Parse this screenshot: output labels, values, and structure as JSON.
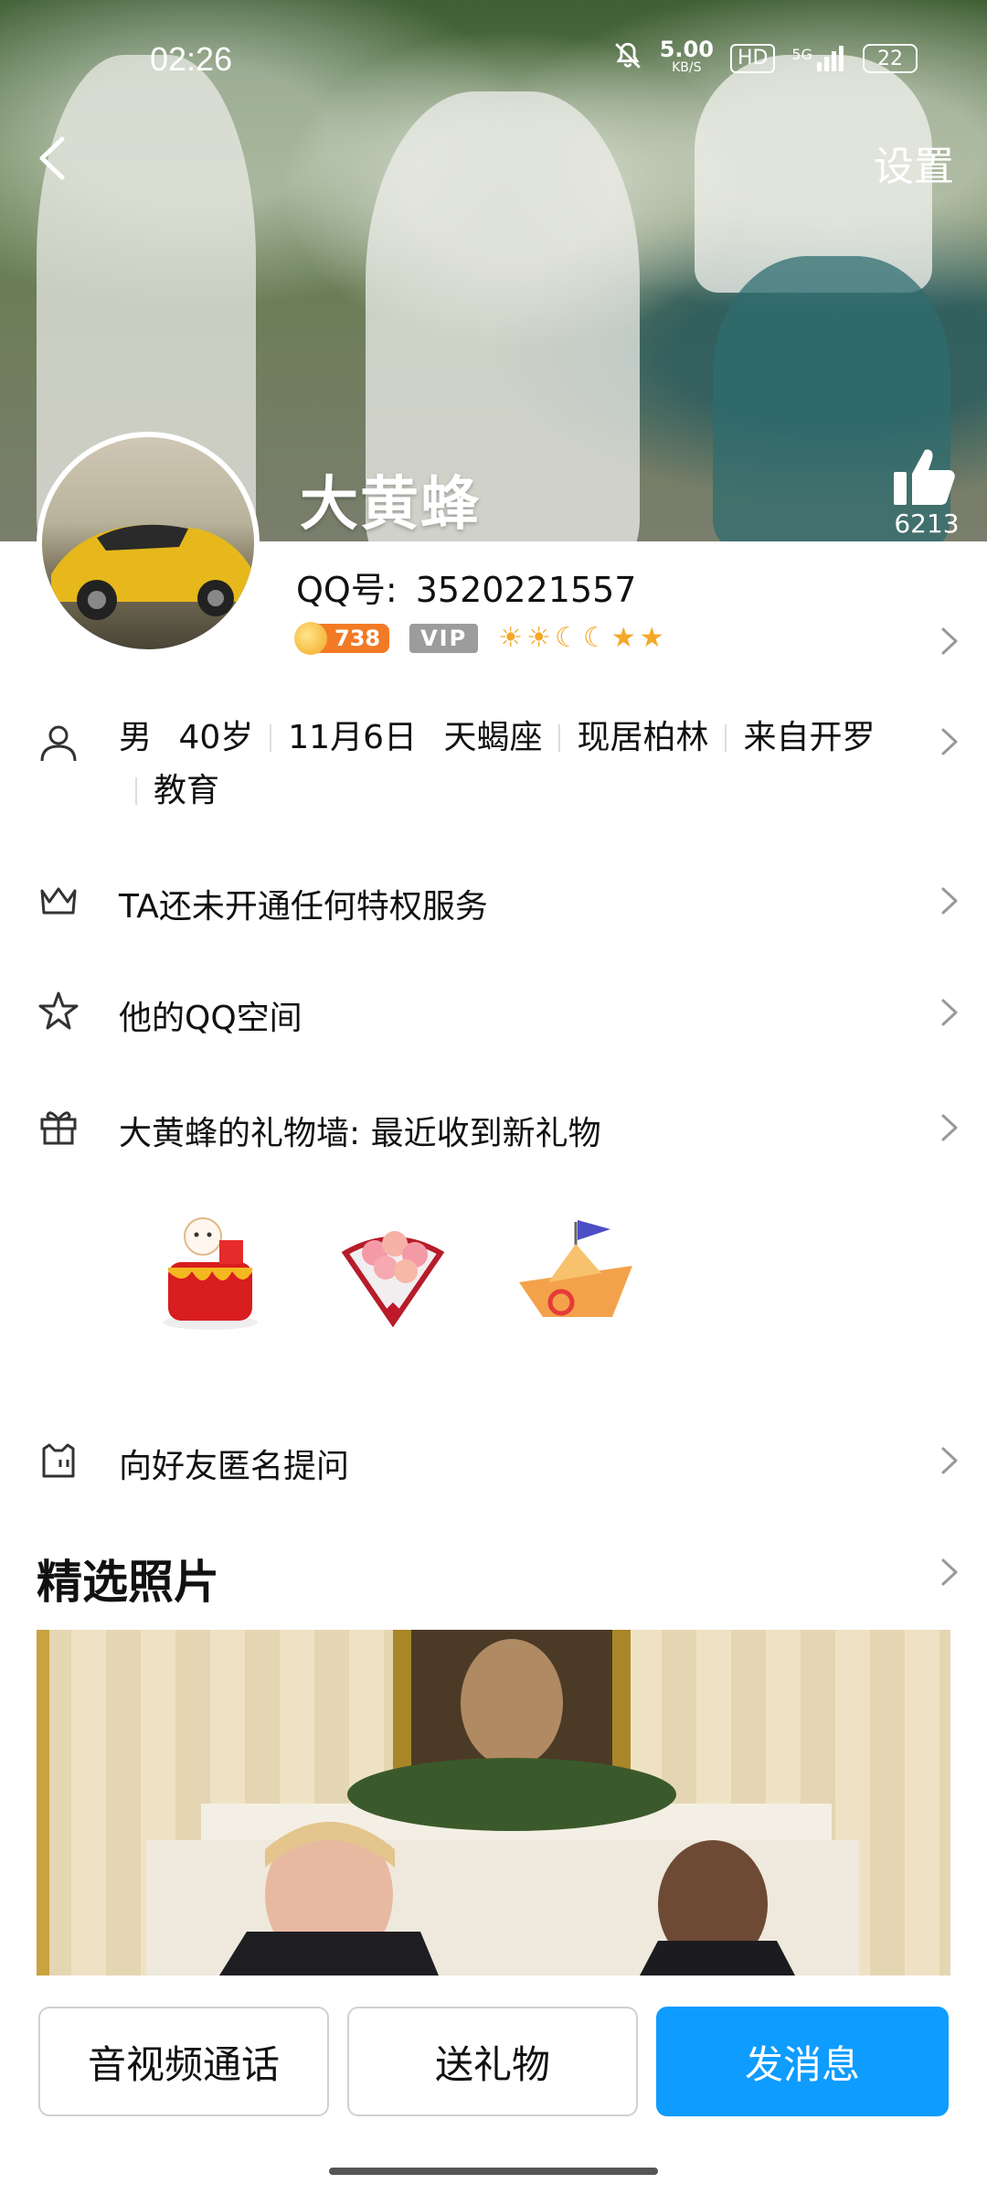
{
  "status_bar": {
    "time": "02:26",
    "net_speed": "5.00",
    "net_unit": "KB/S",
    "hd": "HD",
    "network": "5G",
    "battery": "22"
  },
  "header": {
    "settings_label": "设置",
    "like_count": "6213",
    "display_name": "大黄蜂"
  },
  "profile": {
    "qq_label": "QQ号:",
    "qq_number": "3520221557",
    "coin_level": "738",
    "vip_label": "VIP",
    "level_icons": [
      "sun-icon",
      "sun-icon",
      "moon-icon",
      "moon-icon",
      "star-icon",
      "star-icon"
    ]
  },
  "info": {
    "gender": "男",
    "age": "40岁",
    "birthday": "11月6日",
    "zodiac": "天蝎座",
    "residence": "现居柏林",
    "hometown": "来自开罗",
    "hometown_part1": "来自开",
    "hometown_part2": "罗",
    "occupation": "教育"
  },
  "rows": {
    "privilege": "TA还未开通任何特权服务",
    "qzone": "他的QQ空间",
    "gift_wall": "大黄蜂的礼物墙: 最近收到新礼物",
    "anon_question": "向好友匿名提问"
  },
  "gifts": [
    "cake-gift-icon",
    "bouquet-gift-icon",
    "paper-boat-gift-icon"
  ],
  "photos": {
    "section_title": "精选照片"
  },
  "bottom_bar": {
    "call_label": "音视频通话",
    "gift_label": "送礼物",
    "message_label": "发消息"
  },
  "colors": {
    "primary": "#0e9cff",
    "coin_badge": "#f27a25",
    "vip_badge": "#9c9c9c",
    "level_icon": "#f4a82a"
  }
}
